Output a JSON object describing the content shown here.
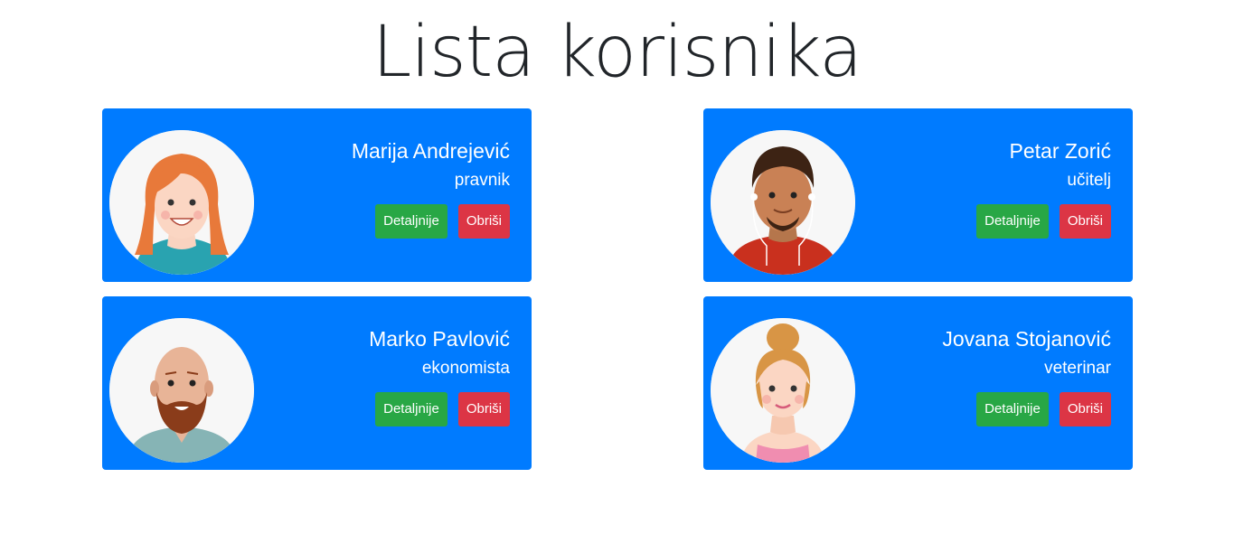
{
  "page": {
    "title": "Lista korisnika"
  },
  "colors": {
    "card_bg": "#007bff",
    "details_button": "#28a745",
    "delete_button": "#dc3545",
    "title_text": "#212529"
  },
  "users": [
    {
      "name": "Marija Andrejević",
      "job": "pravnik",
      "avatar_icon": "woman-red-hair-avatar",
      "details_label": "Detaljnije",
      "delete_label": "Obriši"
    },
    {
      "name": "Petar Zorić",
      "job": "učitelj",
      "avatar_icon": "man-earphones-avatar",
      "details_label": "Detaljnije",
      "delete_label": "Obriši"
    },
    {
      "name": "Marko Pavlović",
      "job": "ekonomista",
      "avatar_icon": "bald-bearded-man-avatar",
      "details_label": "Detaljnije",
      "delete_label": "Obriši"
    },
    {
      "name": "Jovana Stojanović",
      "job": "veterinar",
      "avatar_icon": "woman-blonde-bun-avatar",
      "details_label": "Detaljnije",
      "delete_label": "Obriši"
    }
  ]
}
